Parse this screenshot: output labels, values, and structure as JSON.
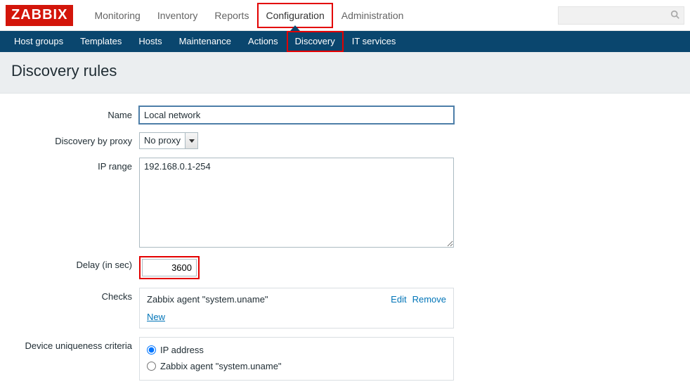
{
  "brand": "ZABBIX",
  "nav1": {
    "monitoring": "Monitoring",
    "inventory": "Inventory",
    "reports": "Reports",
    "configuration": "Configuration",
    "administration": "Administration"
  },
  "nav2": {
    "host_groups": "Host groups",
    "templates": "Templates",
    "hosts": "Hosts",
    "maintenance": "Maintenance",
    "actions": "Actions",
    "discovery": "Discovery",
    "it_services": "IT services"
  },
  "page_title": "Discovery rules",
  "form": {
    "labels": {
      "name": "Name",
      "discovery_by_proxy": "Discovery by proxy",
      "ip_range": "IP range",
      "delay": "Delay (in sec)",
      "checks": "Checks",
      "criteria": "Device uniqueness criteria"
    },
    "name_value": "Local network",
    "proxy_value": "No proxy",
    "ip_range_value": "192.168.0.1-254",
    "delay_value": "3600",
    "checks": {
      "item": "Zabbix agent \"system.uname\"",
      "edit": "Edit",
      "remove": "Remove",
      "new": "New"
    },
    "criteria": {
      "ip": "IP address",
      "agent": "Zabbix agent \"system.uname\""
    }
  }
}
